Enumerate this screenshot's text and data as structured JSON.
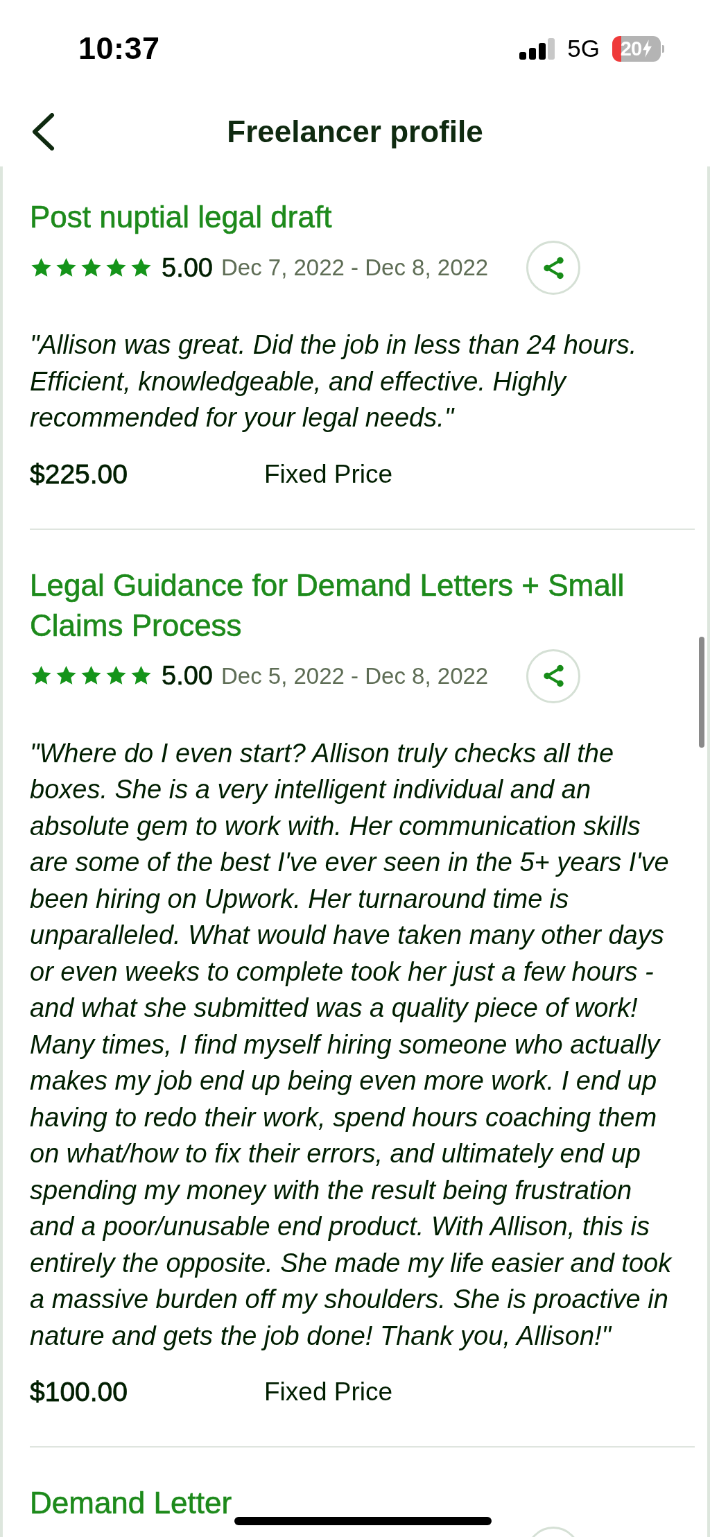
{
  "status_bar": {
    "time": "10:37",
    "network": "5G",
    "battery": "20"
  },
  "header": {
    "title": "Freelancer profile"
  },
  "reviews": [
    {
      "title": "Post nuptial legal draft",
      "stars": 5,
      "rating": "5.00",
      "dates": "Dec 7, 2022 - Dec 8, 2022",
      "quote": "\"Allison was great. Did the job in less than 24 hours. Efficient, knowledgeable, and effective. Highly recommended for your legal needs.\"",
      "price": "$225.00",
      "price_type": "Fixed Price"
    },
    {
      "title": "Legal Guidance for Demand Letters + Small Claims Process",
      "stars": 5,
      "rating": "5.00",
      "dates": "Dec 5, 2022 - Dec 8, 2022",
      "quote": "\"Where do I even start? Allison truly checks all the boxes. She is a very intelligent individual and an absolute gem to work with. Her communication skills are some of the best I've ever seen in the 5+ years I've been hiring on Upwork. Her turnaround time is unparalleled. What would have taken many other days or even weeks to complete took her just a few hours - and what she submitted was a quality piece of work! Many times, I find myself hiring someone who actually makes my job end up being even more work. I end up having to redo their work, spend hours coaching them on what/how to fix their errors, and ultimately end up spending my money with the result being frustration and a poor/unusable end product. With Allison, this is entirely the opposite. She made my life easier and took a massive burden off my shoulders. She is proactive in nature and gets the job done! Thank you, Allison!\"",
      "price": "$100.00",
      "price_type": "Fixed Price"
    },
    {
      "title": "Demand Letter"
    }
  ]
}
